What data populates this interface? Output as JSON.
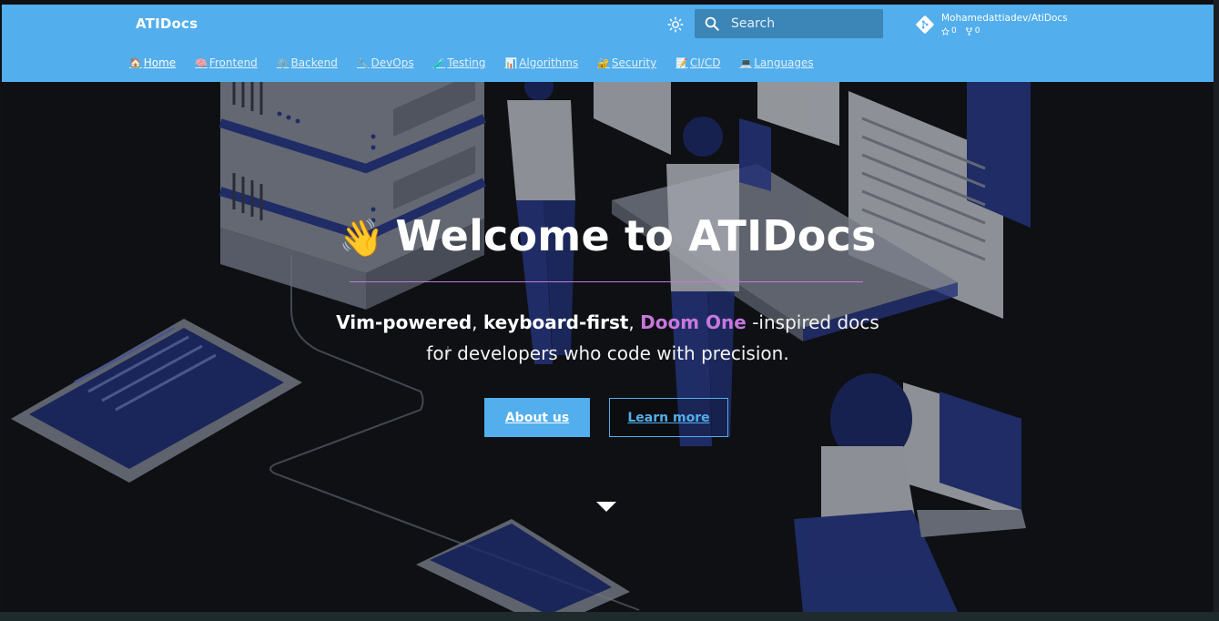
{
  "header": {
    "site_title": "ATIDocs",
    "search_placeholder": "Search",
    "repo": {
      "name": "Mohamedattiadev/AtiDocs",
      "stars": "0",
      "forks": "0"
    },
    "tabs": [
      {
        "icon": "🏠",
        "label": "Home"
      },
      {
        "icon": "🧠",
        "label": "Frontend"
      },
      {
        "icon": "⚙️",
        "label": "Backend"
      },
      {
        "icon": "🔧",
        "label": "DevOps"
      },
      {
        "icon": "🧪",
        "label": "Testing"
      },
      {
        "icon": "📊",
        "label": "Algorithms"
      },
      {
        "icon": "🔐",
        "label": "Security"
      },
      {
        "icon": "📝",
        "label": "CI/CD"
      },
      {
        "icon": "💻",
        "label": "Languages"
      }
    ]
  },
  "hero": {
    "wave_emoji": "👋",
    "title": "Welcome to ATIDocs",
    "tagline_part1": "Vim-powered",
    "tagline_sep1": ", ",
    "tagline_part2": "keyboard-first",
    "tagline_sep2": ", ",
    "tagline_accent": "Doom One",
    "tagline_part3": " -inspired docs",
    "tagline_line2": "for developers who code with precision.",
    "primary_button": "About us",
    "secondary_button": "Learn more"
  },
  "colors": {
    "header_bg": "#52aeec",
    "accent_purple": "#c678dd",
    "hero_bg": "#121418"
  }
}
